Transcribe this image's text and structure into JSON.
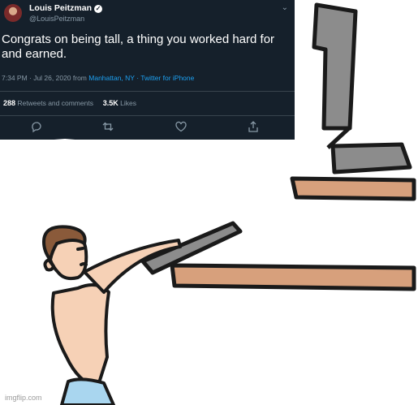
{
  "tweet": {
    "author_name": "Louis Peitzman",
    "author_handle": "@LouisPeitzman",
    "text": "Congrats on being tall, a thing you worked hard for and earned.",
    "time_prefix": "7:34 PM · Jul 26, 2020 from",
    "location": "Manhattan, NY",
    "source": "· Twitter for iPhone",
    "retweets_count": "288",
    "retweets_label": "Retweets and comments",
    "likes_count": "3.5K",
    "likes_label": "Likes",
    "icons": [
      "verified-badge",
      "chevron-down-icon",
      "reply-icon",
      "retweet-icon",
      "like-icon",
      "share-icon"
    ]
  },
  "meme": {
    "watermark": "imgflip.com",
    "colors": {
      "tweet_bg": "#15202b",
      "shelf_wood": "#d7a07c",
      "monitor_gray": "#8c8c8c",
      "skin": "#f6d1b6",
      "shorts": "#a9d6ef"
    }
  }
}
